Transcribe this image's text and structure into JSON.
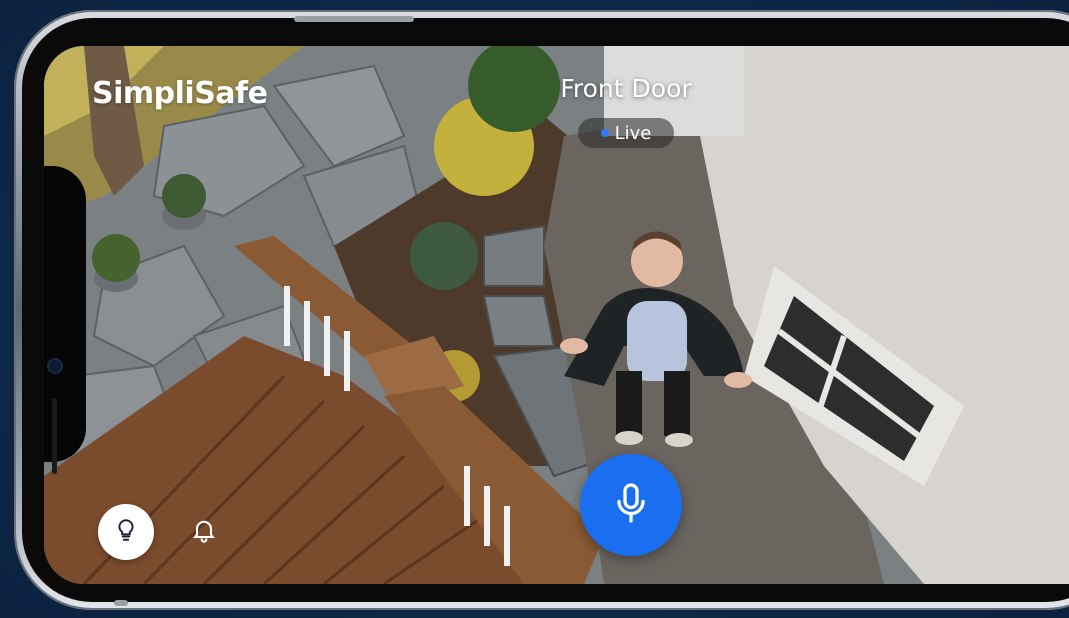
{
  "app": {
    "brand": "SimpliSafe",
    "camera_name": "Front Door",
    "status_label": "Live",
    "status_color": "#2f7bff",
    "accent_color": "#1a6ef0"
  },
  "controls": {
    "light_icon": "lightbulb-icon",
    "notification_icon": "bell-icon",
    "talk_icon": "microphone-icon"
  }
}
